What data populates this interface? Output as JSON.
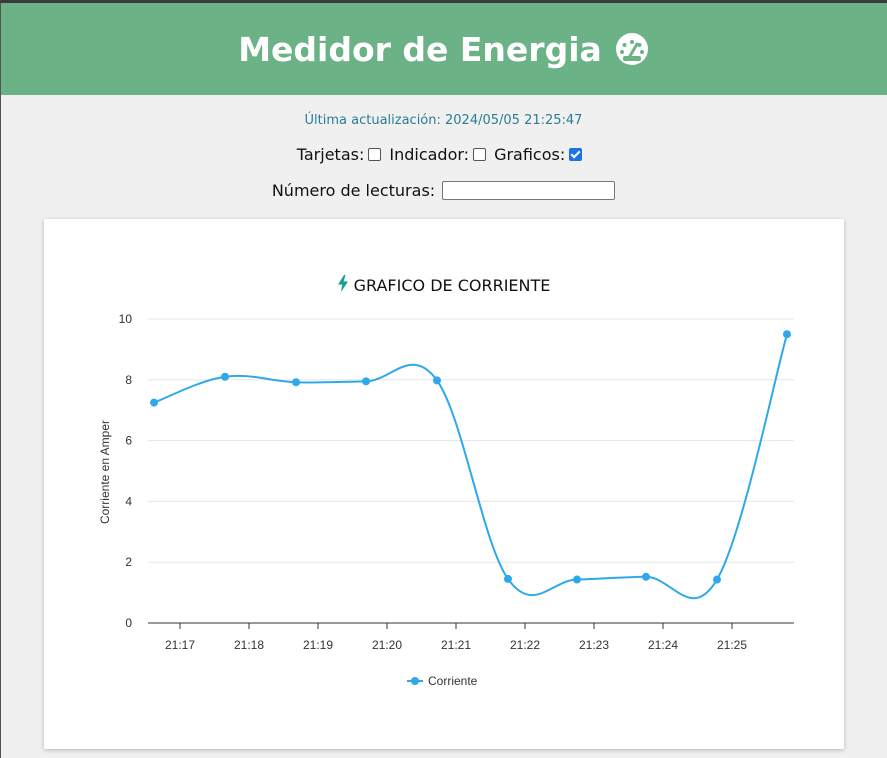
{
  "header": {
    "title": "Medidor de Energia",
    "icon": "gauge-icon",
    "bg_color": "#6cb287"
  },
  "status": {
    "last_update": "Última actualización: 2024/05/05 21:25:47"
  },
  "toggles": {
    "cards_label": "Tarjetas:",
    "cards_checked": false,
    "indicator_label": "Indicador:",
    "indicator_checked": false,
    "charts_label": "Graficos:",
    "charts_checked": true
  },
  "readings": {
    "label": "Número de lecturas:",
    "value": ""
  },
  "chart_data": {
    "type": "line",
    "title": "GRAFICO DE CORRIENTE",
    "title_icon": "bolt-icon",
    "ylabel": "Corriente en Amper",
    "xlabel": "",
    "ylim": [
      0,
      10
    ],
    "yticks": [
      "10",
      "8",
      "6",
      "4",
      "2",
      "0"
    ],
    "xticks": [
      "21:17",
      "21:18",
      "21:19",
      "21:20",
      "21:21",
      "21:22",
      "21:23",
      "21:24",
      "21:25"
    ],
    "grid": true,
    "legend_position": "bottom",
    "series": [
      {
        "name": "Corriente",
        "color": "#2fa8ea",
        "values": [
          7.25,
          8.1,
          7.92,
          7.95,
          7.98,
          1.45,
          1.43,
          1.52,
          1.43,
          9.5
        ]
      }
    ]
  }
}
